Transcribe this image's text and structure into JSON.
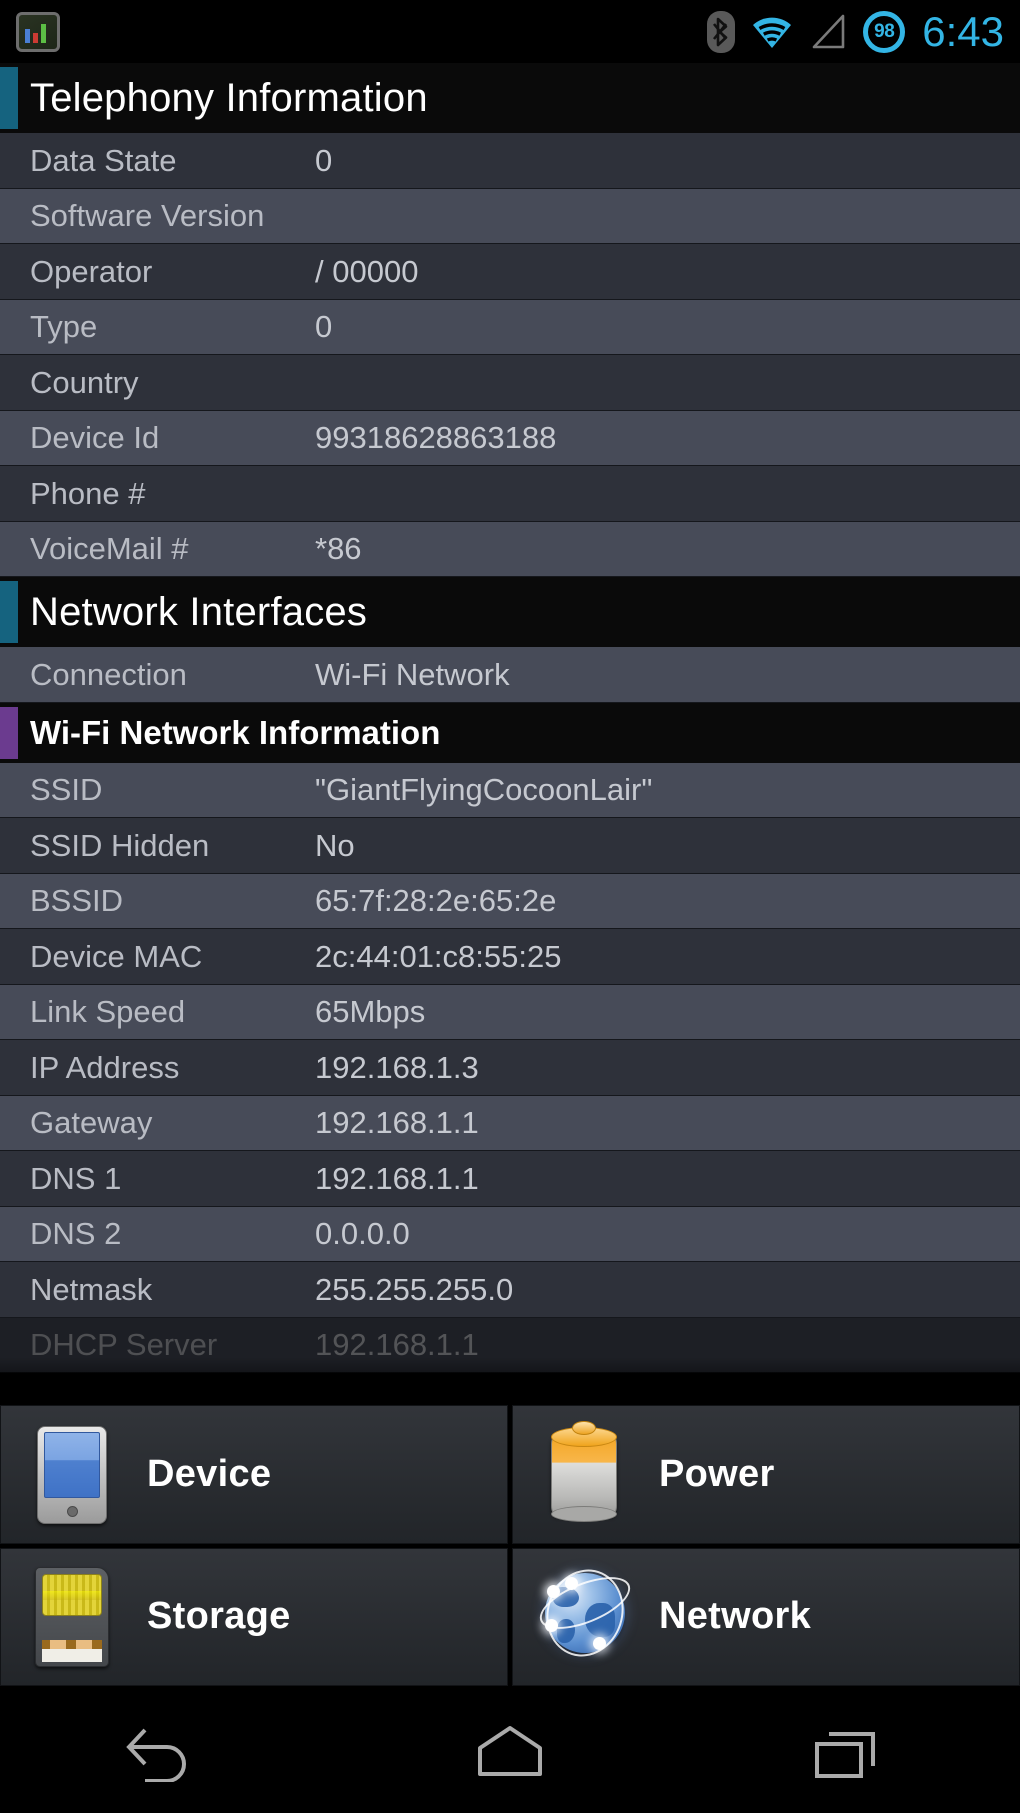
{
  "statusbar": {
    "notification_icon": "system-monitor-icon",
    "bluetooth_icon": "bluetooth-icon",
    "wifi_icon": "wifi-icon",
    "signal_icon": "cell-signal-icon",
    "battery_level": "98",
    "time": "6:43",
    "accent_color": "#33b5e5"
  },
  "sections": [
    {
      "title": "Telephony Information",
      "accent": "teal",
      "accent_color": "#15637f",
      "rows": [
        {
          "key": "Data State",
          "value": "0"
        },
        {
          "key": "Software Version",
          "value": ""
        },
        {
          "key": "Operator",
          "value": "/ 00000"
        },
        {
          "key": "Type",
          "value": "0"
        },
        {
          "key": "Country",
          "value": ""
        },
        {
          "key": "Device Id",
          "value": "99318628863188"
        },
        {
          "key": "Phone #",
          "value": ""
        },
        {
          "key": "VoiceMail #",
          "value": "*86"
        }
      ]
    },
    {
      "title": "Network Interfaces",
      "accent": "teal",
      "accent_color": "#15637f",
      "rows": [
        {
          "key": "Connection",
          "value": "Wi-Fi Network"
        }
      ]
    },
    {
      "title": "Wi-Fi Network Information",
      "accent": "purple",
      "accent_color": "#6b3b8f",
      "sub": true,
      "rows": [
        {
          "key": "SSID",
          "value": "\"GiantFlyingCocoonLair\""
        },
        {
          "key": "SSID Hidden",
          "value": "No"
        },
        {
          "key": "BSSID",
          "value": "65:7f:28:2e:65:2e"
        },
        {
          "key": "Device MAC",
          "value": "2c:44:01:c8:55:25"
        },
        {
          "key": "Link Speed",
          "value": "65Mbps"
        },
        {
          "key": "IP Address",
          "value": "192.168.1.3"
        },
        {
          "key": "Gateway",
          "value": "192.168.1.1"
        },
        {
          "key": "DNS 1",
          "value": "192.168.1.1"
        },
        {
          "key": "DNS 2",
          "value": "0.0.0.0"
        },
        {
          "key": "Netmask",
          "value": "255.255.255.0"
        },
        {
          "key": "DHCP Server",
          "value": "192.168.1.1"
        }
      ]
    }
  ],
  "tiles": [
    {
      "label": "Device",
      "icon": "device-phone-icon"
    },
    {
      "label": "Power",
      "icon": "battery-icon"
    },
    {
      "label": "Storage",
      "icon": "sd-card-icon"
    },
    {
      "label": "Network",
      "icon": "globe-icon"
    }
  ],
  "navbar": [
    {
      "name": "back-button",
      "icon": "back-arrow-icon"
    },
    {
      "name": "home-button",
      "icon": "home-icon"
    },
    {
      "name": "recents-button",
      "icon": "recents-icon"
    }
  ]
}
